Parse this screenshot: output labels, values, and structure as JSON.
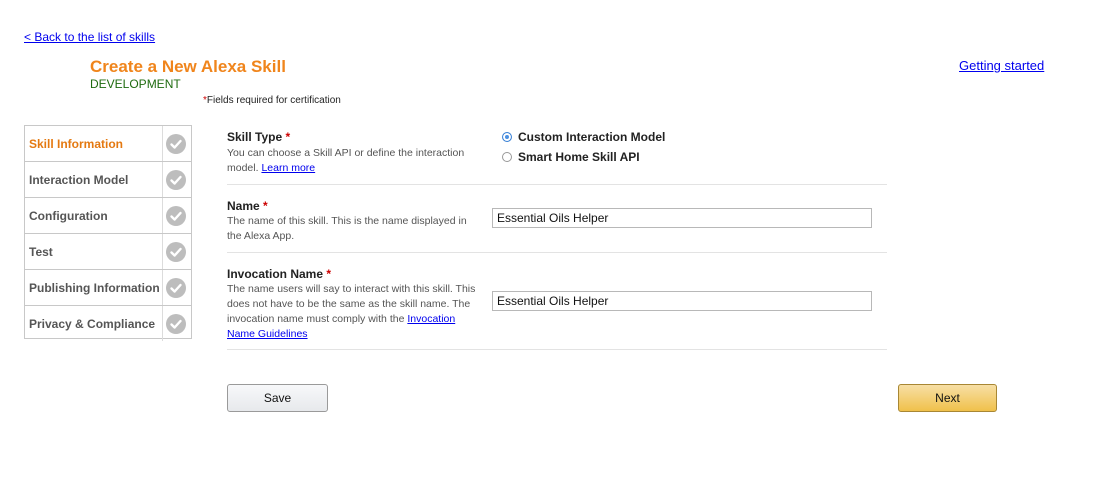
{
  "header": {
    "back_link": "< Back to the list of skills",
    "title": "Create a New Alexa Skill",
    "subtitle": "DEVELOPMENT",
    "required_star": "*",
    "required_note": "Fields required for certification",
    "getting_started": "Getting started"
  },
  "sidebar": {
    "items": [
      {
        "label": "Skill Information",
        "icon": "check-icon"
      },
      {
        "label": "Interaction Model",
        "icon": "check-icon"
      },
      {
        "label": "Configuration",
        "icon": "check-icon"
      },
      {
        "label": "Test",
        "icon": "check-icon"
      },
      {
        "label": "Publishing Information",
        "icon": "check-icon"
      },
      {
        "label": "Privacy & Compliance",
        "icon": "check-icon"
      }
    ],
    "active_color": "#e47911"
  },
  "form": {
    "skill_type": {
      "label": "Skill Type",
      "star": "*",
      "desc": "You can choose a Skill API or define the interaction model.",
      "learn_more": "Learn more",
      "options": [
        "Custom Interaction Model",
        "Smart Home Skill API"
      ],
      "selected": "Custom Interaction Model"
    },
    "name": {
      "label": "Name",
      "star": "*",
      "desc": "The name of this skill. This is the name displayed in the Alexa App.",
      "value": "Essential Oils Helper"
    },
    "invocation": {
      "label": "Invocation Name",
      "star": "*",
      "desc": "The name users will say to interact with this skill. This does not have to be the same as the skill name. The invocation name must comply with the",
      "guidelines_link": "Invocation Name Guidelines",
      "value": "Essential Oils Helper"
    }
  },
  "buttons": {
    "save": "Save",
    "next": "Next"
  },
  "colors": {
    "title": "#f0851c",
    "subtitle": "#1e6b0f",
    "next_button": "#f0c14b"
  }
}
